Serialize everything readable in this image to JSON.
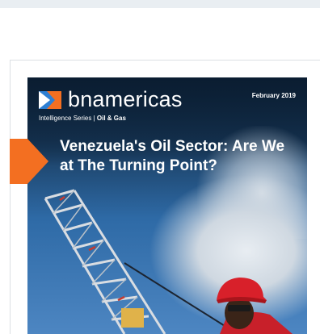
{
  "cover": {
    "brand": "bnamericas",
    "date": "February 2019",
    "series_prefix": "Intelligence Series | ",
    "series_sector": "Oil & Gas",
    "headline": "Venezuela's Oil Sector: Are We at The Turning Point?"
  },
  "colors": {
    "accent_orange": "#f36f21",
    "brand_blue": "#2d7fd3",
    "helmet_red": "#d8202a"
  },
  "icons": {
    "logo": "bnamericas-logo-icon",
    "arrow": "arrow-tab-icon"
  }
}
